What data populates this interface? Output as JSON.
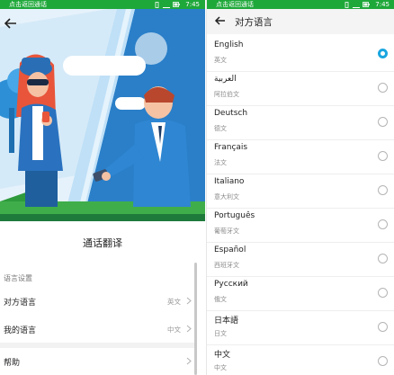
{
  "colors": {
    "status_bar": "#1fa83a",
    "accent": "#1aa6e0"
  },
  "left": {
    "status_bar": {
      "back_to_call": "点击返回通话",
      "time": "7:45"
    },
    "feature_title": "通话翻译",
    "section_label": "语言设置",
    "rows": [
      {
        "label": "对方语言",
        "value": "英文"
      },
      {
        "label": "我的语言",
        "value": "中文"
      },
      {
        "label": "帮助",
        "value": ""
      }
    ]
  },
  "right": {
    "status_bar": {
      "back_to_call": "点击返回通话",
      "time": "7:45"
    },
    "title": "对方语言",
    "languages": [
      {
        "name": "English",
        "sub": "英文",
        "selected": true
      },
      {
        "name": "العربية",
        "sub": "阿拉伯文",
        "selected": false
      },
      {
        "name": "Deutsch",
        "sub": "德文",
        "selected": false
      },
      {
        "name": "Français",
        "sub": "法文",
        "selected": false
      },
      {
        "name": "Italiano",
        "sub": "意大利文",
        "selected": false
      },
      {
        "name": "Português",
        "sub": "葡萄牙文",
        "selected": false
      },
      {
        "name": "Español",
        "sub": "西班牙文",
        "selected": false
      },
      {
        "name": "Русский",
        "sub": "俄文",
        "selected": false
      },
      {
        "name": "日本語",
        "sub": "日文",
        "selected": false
      },
      {
        "name": "中文",
        "sub": "中文",
        "selected": false
      }
    ]
  }
}
